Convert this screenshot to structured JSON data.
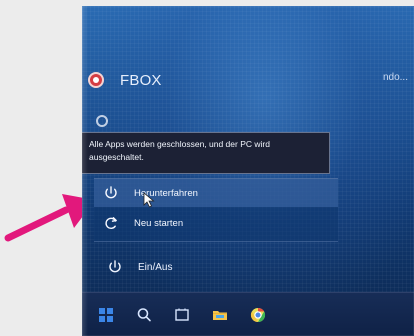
{
  "screen": {
    "username": "FBOX",
    "user_menu_partial": "ndo..."
  },
  "tooltip": {
    "text": "Alle Apps werden geschlossen, und der PC wird ausgeschaltet."
  },
  "power_menu": {
    "items": [
      {
        "label": "Herunterfahren",
        "icon": "power-icon"
      },
      {
        "label": "Neu starten",
        "icon": "restart-icon"
      }
    ],
    "footer_label": "Ein/Aus"
  },
  "taskbar": {
    "icons": [
      "windows-start-icon",
      "search-icon",
      "task-view-icon",
      "file-explorer-icon",
      "chrome-icon"
    ]
  },
  "colors": {
    "desktop_top": "#2a6bb3",
    "desktop_bottom": "#0b264d",
    "tooltip_bg": "#1c2135",
    "menu_highlight": "#4e78b9",
    "arrow": "#e2187c",
    "avatar": "#d43d43"
  },
  "annotation": {
    "arrow_color": "#e2187c"
  }
}
